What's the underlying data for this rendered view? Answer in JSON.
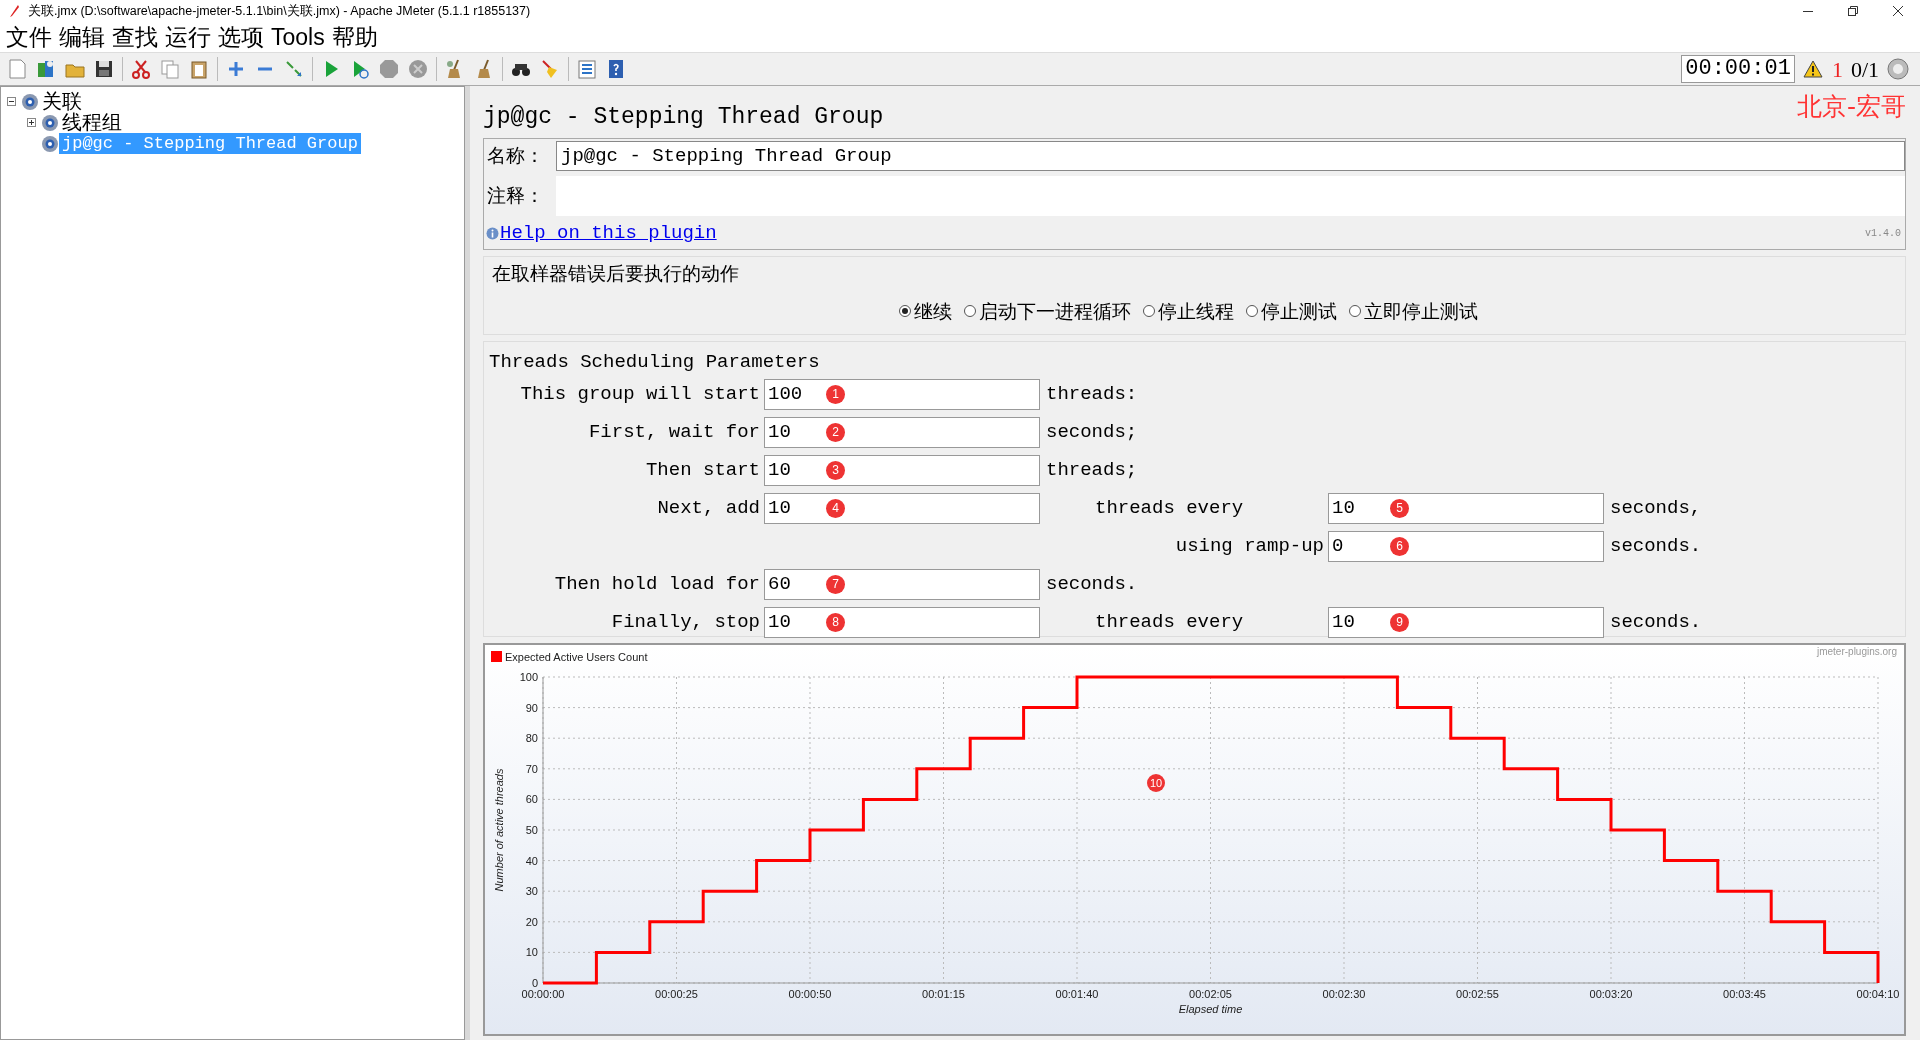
{
  "window": {
    "title": "关联.jmx (D:\\software\\apache-jmeter-5.1.1\\bin\\关联.jmx) - Apache JMeter (5.1.1 r1855137)"
  },
  "menu": [
    {
      "label": "文件"
    },
    {
      "label": "编辑"
    },
    {
      "label": "查找"
    },
    {
      "label": "运行"
    },
    {
      "label": "选项"
    },
    {
      "label": "Tools"
    },
    {
      "label": "帮助"
    }
  ],
  "status": {
    "timer": "00:00:01",
    "warnings": "1",
    "threads": "0/1"
  },
  "tree": [
    {
      "label": "关联",
      "expanded": true,
      "selected": false,
      "children": [
        {
          "label": "线程组",
          "expanded": false,
          "selected": false
        },
        {
          "label": "jp@gc - Stepping Thread Group",
          "selected": true
        }
      ]
    }
  ],
  "panel": {
    "title": "jp@gc - Stepping Thread Group",
    "author_note": "北京-宏哥",
    "name_label": "名称：",
    "name_value": "jp@gc - Stepping Thread Group",
    "comment_label": "注释：",
    "help_link": "Help on this plugin",
    "version": "v1.4.0",
    "error_action": {
      "title": "在取样器错误后要执行的动作",
      "options": [
        {
          "label": "继续",
          "selected": true
        },
        {
          "label": "启动下一进程循环",
          "selected": false
        },
        {
          "label": "停止线程",
          "selected": false
        },
        {
          "label": "停止测试",
          "selected": false
        },
        {
          "label": "立即停止测试",
          "selected": false
        }
      ]
    },
    "scheduling": {
      "title": "Threads Scheduling Parameters",
      "rows": [
        {
          "kind": "single",
          "label": "This group will start",
          "value": "100",
          "badge": "1",
          "unit": "threads:"
        },
        {
          "kind": "single",
          "label": "First, wait for",
          "value": "10",
          "badge": "2",
          "unit": "seconds;"
        },
        {
          "kind": "single",
          "label": "Then start",
          "value": "10",
          "badge": "3",
          "unit": "threads;"
        },
        {
          "kind": "pair",
          "label": "Next, add",
          "value": "10",
          "badge": "4",
          "label2": "threads every",
          "value2": "10",
          "badge2": "5",
          "unit2": "seconds,"
        },
        {
          "kind": "second",
          "label2": "using ramp-up",
          "value2": "0",
          "badge2": "6",
          "unit2": "seconds."
        },
        {
          "kind": "single",
          "label": "Then hold load for",
          "value": "60",
          "badge": "7",
          "unit": "seconds."
        },
        {
          "kind": "pair",
          "label": "Finally, stop",
          "value": "10",
          "badge": "8",
          "label2": "threads every",
          "value2": "10",
          "badge2": "9",
          "unit2": "seconds."
        }
      ]
    },
    "chart": {
      "credit": "jmeter-plugins.org",
      "badge": "10",
      "chart_data": {
        "type": "line",
        "grid": true,
        "xlabel": "Elapsed time",
        "ylabel": "Number of active threads",
        "xlim": [
          0,
          250
        ],
        "ylim": [
          0,
          100
        ],
        "xticks": [
          {
            "value": 0,
            "label": "00:00:00"
          },
          {
            "value": 25,
            "label": "00:00:25"
          },
          {
            "value": 50,
            "label": "00:00:50"
          },
          {
            "value": 75,
            "label": "00:01:15"
          },
          {
            "value": 100,
            "label": "00:01:40"
          },
          {
            "value": 125,
            "label": "00:02:05"
          },
          {
            "value": 150,
            "label": "00:02:30"
          },
          {
            "value": 175,
            "label": "00:02:55"
          },
          {
            "value": 200,
            "label": "00:03:20"
          },
          {
            "value": 225,
            "label": "00:03:45"
          },
          {
            "value": 250,
            "label": "00:04:10"
          }
        ],
        "yticks": [
          0,
          10,
          20,
          30,
          40,
          50,
          60,
          70,
          80,
          90,
          100
        ],
        "x": [
          0,
          10,
          10,
          20,
          20,
          30,
          30,
          40,
          40,
          50,
          50,
          60,
          60,
          70,
          70,
          80,
          80,
          90,
          90,
          100,
          100,
          160,
          160,
          170,
          170,
          180,
          180,
          190,
          190,
          200,
          200,
          210,
          210,
          220,
          220,
          230,
          230,
          240,
          240,
          250,
          250
        ],
        "series": [
          {
            "name": "Expected Active Users Count",
            "color": "#ff0000",
            "values": [
              0,
              0,
              10,
              10,
              20,
              20,
              30,
              30,
              40,
              40,
              50,
              50,
              60,
              60,
              70,
              70,
              80,
              80,
              90,
              90,
              100,
              100,
              90,
              90,
              80,
              80,
              70,
              70,
              60,
              60,
              50,
              50,
              40,
              40,
              30,
              30,
              20,
              20,
              10,
              10,
              0
            ]
          }
        ]
      }
    }
  }
}
